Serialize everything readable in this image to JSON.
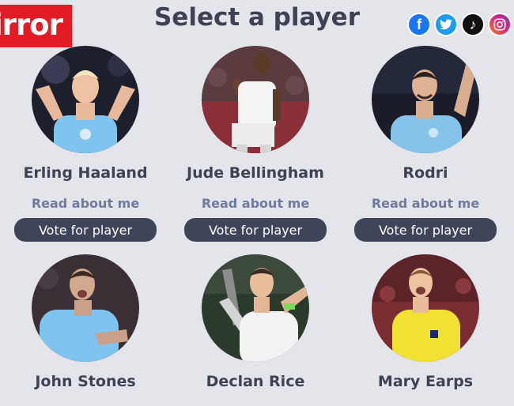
{
  "brand": {
    "logo_text": "irror"
  },
  "header": {
    "title": "Select a player"
  },
  "social": {
    "facebook": "f",
    "twitter": "🐦",
    "tiktok": "♪",
    "instagram": "◎"
  },
  "players": [
    {
      "name": "Erling Haaland",
      "read_label": "Read about me",
      "vote_label": "Vote for player"
    },
    {
      "name": "Jude Bellingham",
      "read_label": "Read about me",
      "vote_label": "Vote for player"
    },
    {
      "name": "Rodri",
      "read_label": "Read about me",
      "vote_label": "Vote for player"
    },
    {
      "name": "John Stones"
    },
    {
      "name": "Declan Rice"
    },
    {
      "name": "Mary Earps"
    }
  ],
  "colors": {
    "background": "#e4e5ea",
    "brand_red": "#e21c25",
    "title_text": "#3d4254",
    "link_text": "#6f7aa0",
    "button_bg": "#3f4558"
  }
}
